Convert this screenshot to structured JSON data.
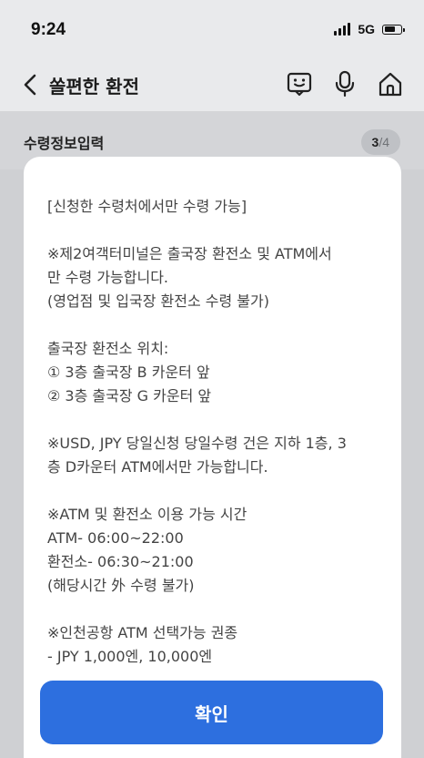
{
  "status_bar": {
    "time": "9:24",
    "network": "5G"
  },
  "header": {
    "title": "쏠편한 환전"
  },
  "step": {
    "title": "수령정보입력",
    "current": "3",
    "separator": "/",
    "total": "4"
  },
  "notice": {
    "lines": [
      "[신청한 수령처에서만 수령 가능]",
      "",
      "※제2여객터미널은 출국장 환전소 및 ATM에서",
      "만 수령 가능합니다.",
      "(영업점 및 입국장 환전소 수령 불가)",
      "",
      "출국장 환전소 위치:",
      "① 3층 출국장 B 카운터 앞",
      "② 3층 출국장 G 카운터 앞",
      "",
      "※USD, JPY 당일신청 당일수령 건은 지하 1층, 3",
      "층 D카운터 ATM에서만 가능합니다.",
      "",
      "※ATM 및 환전소 이용 가능 시간",
      "ATM- 06:00~22:00",
      "환전소- 06:30~21:00",
      "(해당시간 外 수령 불가)",
      "",
      "※인천공항 ATM 선택가능 권종",
      "- JPY 1,000엔, 10,000엔"
    ]
  },
  "confirm_button": {
    "label": "확인"
  }
}
